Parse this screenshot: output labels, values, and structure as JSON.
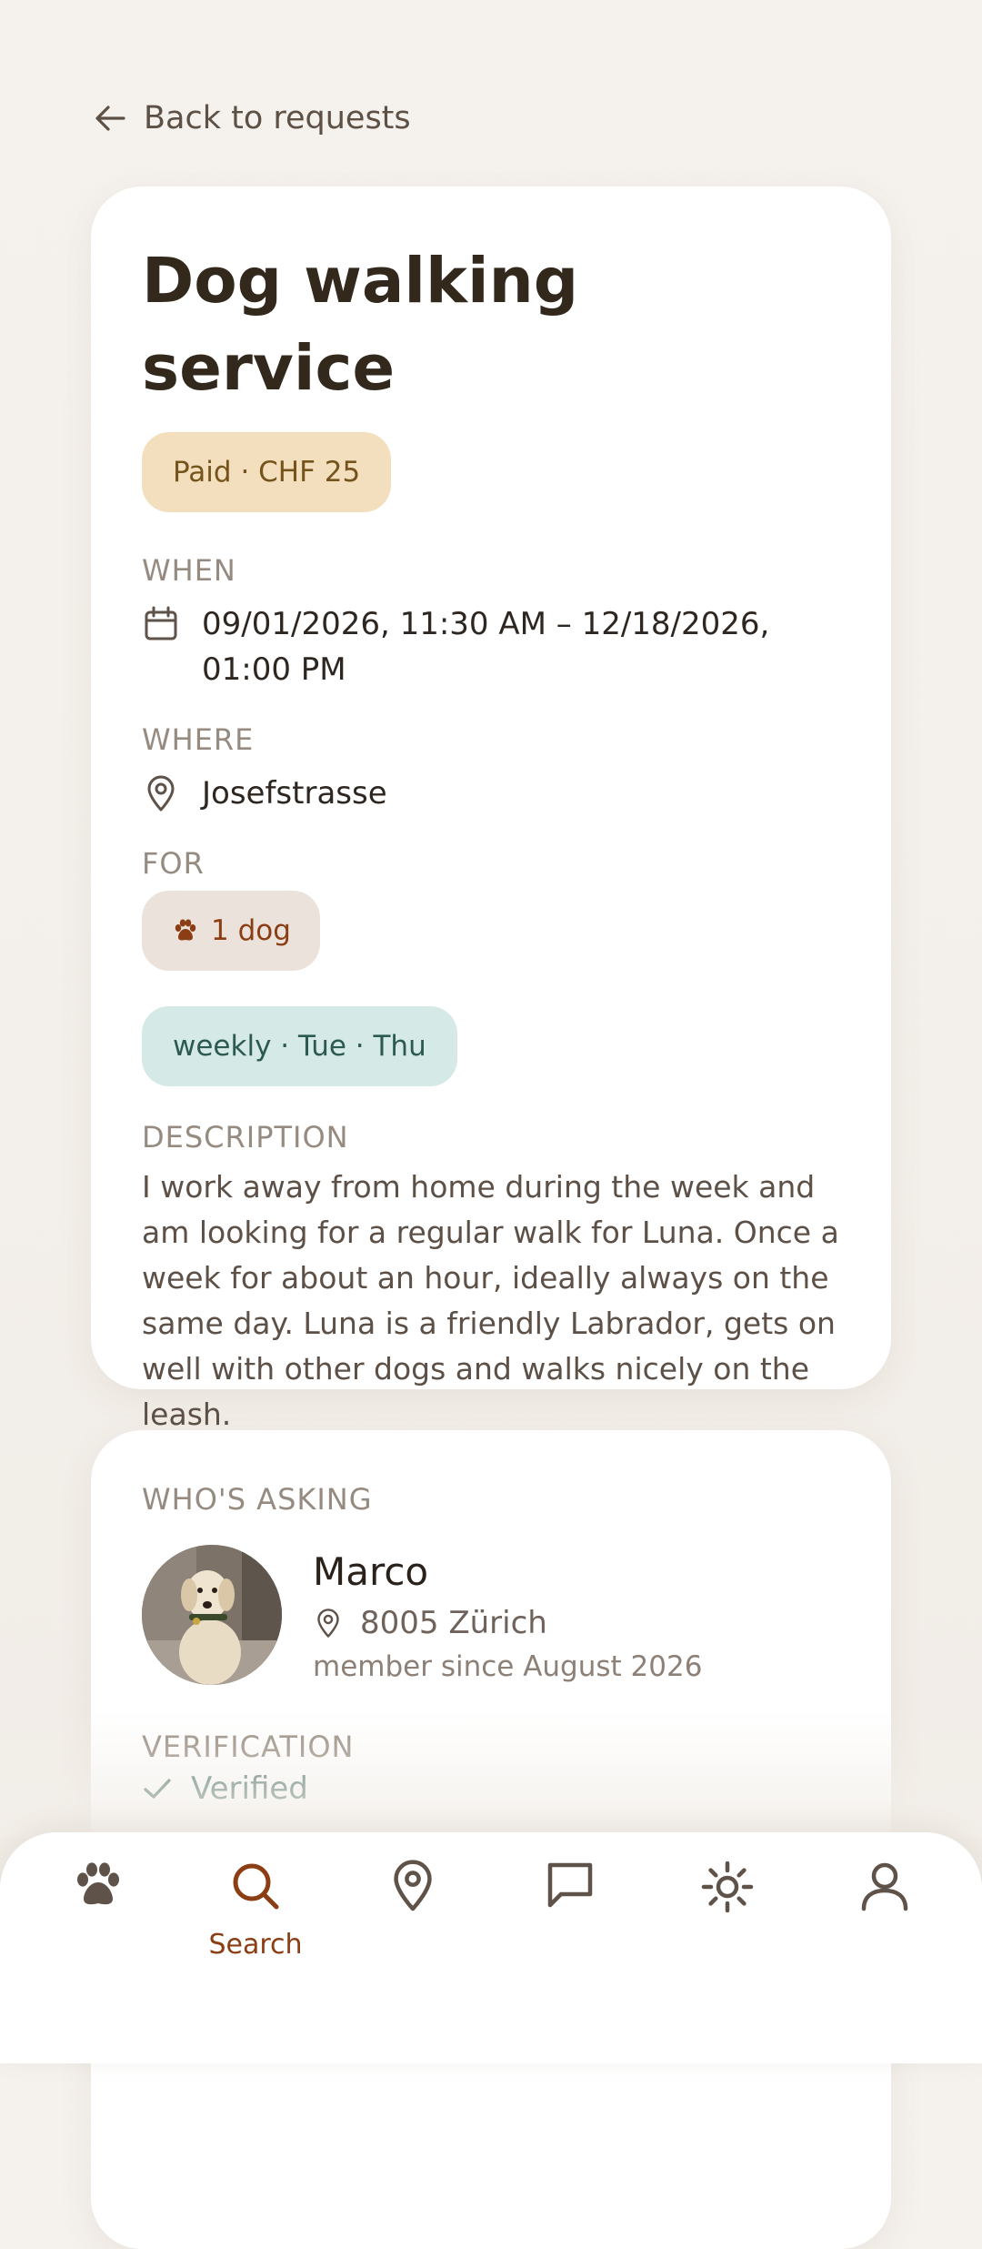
{
  "back": {
    "label": "Back to requests"
  },
  "request": {
    "title": "Dog walking service",
    "payment": "Paid · CHF 25",
    "when_label": "WHEN",
    "when_line1": "09/01/2026, 11:30 AM – 12/18/2026,",
    "when_line2": "01:00 PM",
    "where_label": "WHERE",
    "where_value": "Josefstrasse",
    "for_label": "FOR",
    "for_value": "1 dog",
    "repeat": "weekly · Tue · Thu",
    "description_label": "DESCRIPTION",
    "description": "I work away from home during the week and am looking for a regular walk for Luna. Once a week for about an hour, ideally always on the same day. Luna is a friendly Labrador, gets on well with other dogs and walks nicely on the leash."
  },
  "asker": {
    "label": "WHO'S ASKING",
    "name": "Marco",
    "location": "8005 Zürich",
    "member_since": "member since August 2026",
    "verification_label": "VERIFICATION",
    "verification_status": "Verified"
  },
  "nav": {
    "items": [
      {
        "icon": "paw-icon",
        "label": ""
      },
      {
        "icon": "search-icon",
        "label": "Search",
        "active": true
      },
      {
        "icon": "map-pin-icon",
        "label": ""
      },
      {
        "icon": "chat-icon",
        "label": ""
      },
      {
        "icon": "sun-icon",
        "label": ""
      },
      {
        "icon": "user-icon",
        "label": ""
      }
    ]
  },
  "colors": {
    "accent": "#8b3d14",
    "paid_pill": "#f3dfbd",
    "dog_pill": "#ebe3db",
    "repeat_pill": "#d5e9e6",
    "verified": "#4e7268"
  }
}
